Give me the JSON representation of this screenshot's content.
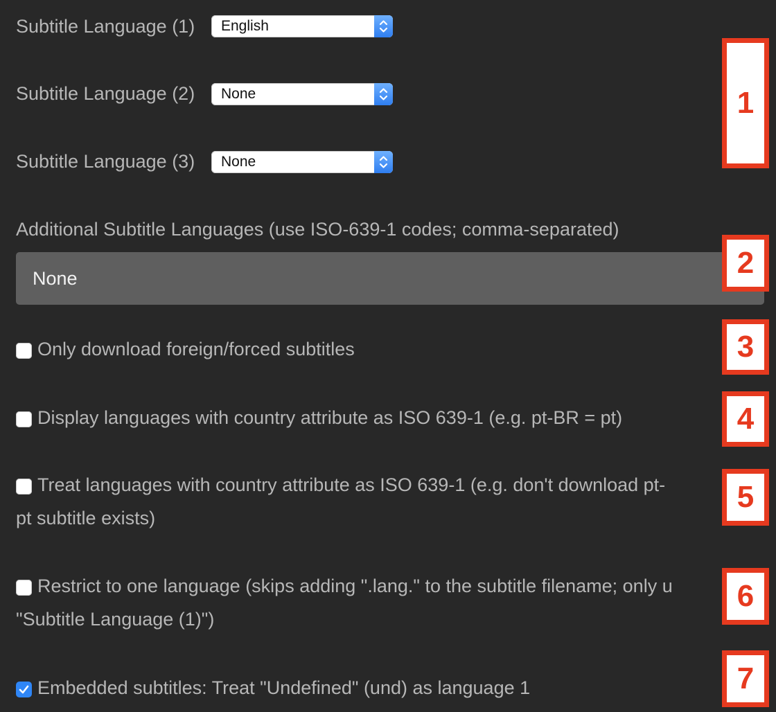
{
  "subtitle_languages": [
    {
      "label": "Subtitle Language (1)",
      "value": "English"
    },
    {
      "label": "Subtitle Language (2)",
      "value": "None"
    },
    {
      "label": "Subtitle Language (3)",
      "value": "None"
    }
  ],
  "additional_languages": {
    "label": "Additional Subtitle Languages (use ISO-639-1 codes; comma-separated)",
    "value": "None"
  },
  "options": [
    {
      "line1": "Only download foreign/forced subtitles",
      "line2": "",
      "checked": false
    },
    {
      "line1": "Display languages with country attribute as ISO 639-1 (e.g. pt-BR = pt)",
      "line2": "",
      "checked": false
    },
    {
      "line1": "Treat languages with country attribute as ISO 639-1 (e.g. don't download pt-",
      "line2": "pt subtitle exists)",
      "checked": false
    },
    {
      "line1": "Restrict to one language (skips adding \".lang.\" to the subtitle filename; only u",
      "line2": "\"Subtitle Language (1)\")",
      "checked": false
    },
    {
      "line1": "Embedded subtitles: Treat \"Undefined\" (und) as language 1",
      "line2": "",
      "checked": true
    }
  ],
  "annotations": [
    "1",
    "2",
    "3",
    "4",
    "5",
    "6",
    "7"
  ],
  "colors": {
    "background": "#282828",
    "label_text": "#b7b7b7",
    "annotation_red": "#e63a1f",
    "checkbox_blue": "#2f86f6"
  }
}
